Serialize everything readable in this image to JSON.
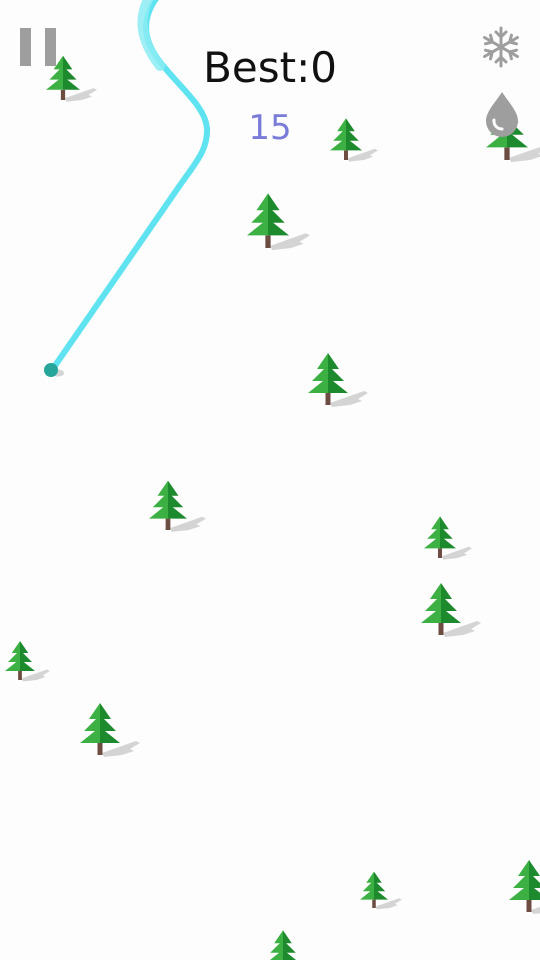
{
  "hud": {
    "best_label": "Best:0",
    "score": "15",
    "pause_icon": "pause-icon",
    "snowflake_icon": "snowflake-icon",
    "drop_icon": "water-drop-icon"
  },
  "colors": {
    "background": "#fdfdfd",
    "trail": "#4fe0ef",
    "ball": "#26a69a",
    "tree_light": "#3cb043",
    "tree_dark": "#1e8a2e",
    "trunk": "#6d4c41",
    "shadow": "#d4d4d4",
    "icon": "#9e9e9e",
    "score": "#7a7cd9"
  }
}
